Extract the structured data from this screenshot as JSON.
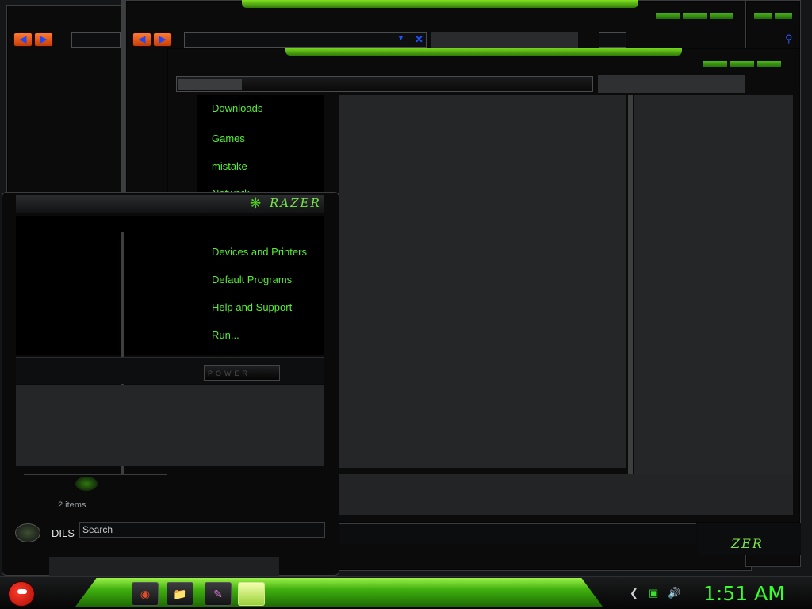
{
  "start_menu": {
    "items_top": [
      "Downloads",
      "Games",
      "mistake",
      "Network"
    ],
    "items_bottom": [
      "Devices and Printers",
      "Default Programs",
      "Help and Support",
      "Run..."
    ],
    "power_label": "POWER",
    "brand": "RAZER"
  },
  "explorer": {
    "status_items": "2 items",
    "user_name": "DILS",
    "search_placeholder": "Search",
    "brand_footer": "ZER"
  },
  "taskbar": {
    "clock": "1:51 AM",
    "pinned": [
      "chrome-icon",
      "folder-icon",
      "paint-icon",
      "active-window"
    ]
  },
  "colors": {
    "accent": "#54ef32",
    "background": "#121314",
    "pane": "#252628"
  }
}
